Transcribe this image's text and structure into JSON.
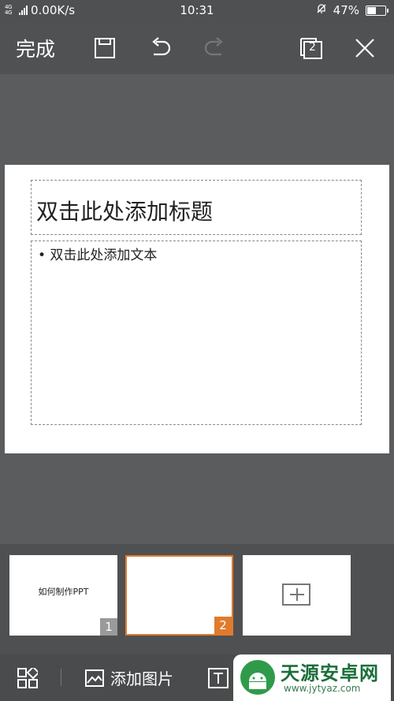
{
  "status_bar": {
    "network": "4G 4G",
    "speed": "0.00K/s",
    "time": "10:31",
    "battery_percent": "47%",
    "battery_level": 0.47
  },
  "toolbar": {
    "done_label": "完成",
    "icons": [
      "save-icon",
      "undo-icon",
      "redo-icon",
      "slides-count-icon",
      "close-icon"
    ],
    "slide_count": "2"
  },
  "slide": {
    "title_placeholder": "双击此处添加标题",
    "body_placeholder": "• 双击此处添加文本"
  },
  "thumbnails": [
    {
      "text": "如何制作PPT",
      "number": "1",
      "selected": false
    },
    {
      "text": "",
      "number": "2",
      "selected": true
    }
  ],
  "bottom_bar": {
    "add_image_label": "添加图片"
  },
  "watermark": {
    "title": "天源安卓网",
    "url": "www.jytyaz.com"
  },
  "colors": {
    "accent": "#e07b2c",
    "toolbar_bg": "#505153",
    "canvas_bg": "#5b5c5e"
  }
}
